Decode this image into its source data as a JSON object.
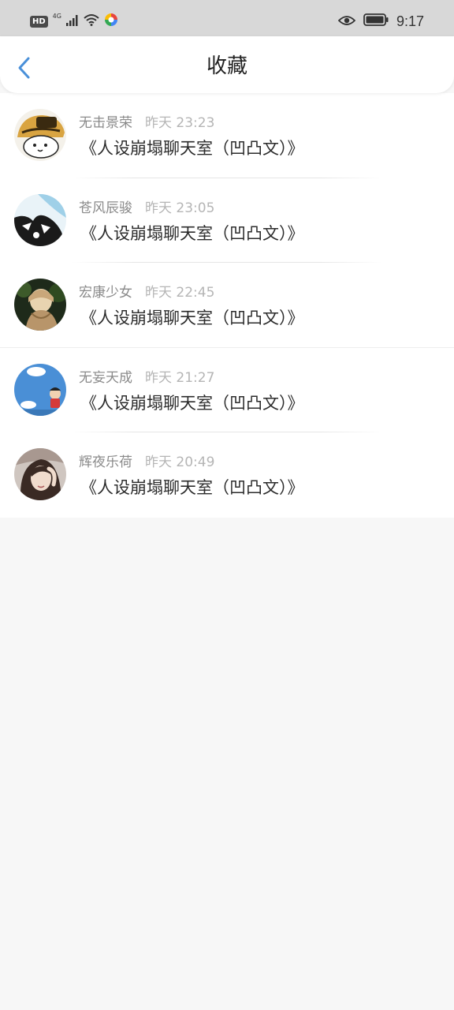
{
  "status_bar": {
    "hd": "HD",
    "network": "4G",
    "time": "9:17"
  },
  "header": {
    "title": "收藏"
  },
  "items": [
    {
      "name": "无击景荣",
      "time": "昨天 23:23",
      "title": "《人设崩塌聊天室（凹凸文）》"
    },
    {
      "name": "苍风辰骏",
      "time": "昨天 23:05",
      "title": "《人设崩塌聊天室（凹凸文）》"
    },
    {
      "name": "宏康少女",
      "time": "昨天 22:45",
      "title": "《人设崩塌聊天室（凹凸文）》"
    },
    {
      "name": "无妄天成",
      "time": "昨天 21:27",
      "title": "《人设崩塌聊天室（凹凸文）》"
    },
    {
      "name": "辉夜乐荷",
      "time": "昨天 20:49",
      "title": "《人设崩塌聊天室（凹凸文）》"
    }
  ],
  "colors": {
    "accent": "#4a90d9",
    "page_background": "#f7f7f7",
    "status_bar": "#d8d8d8"
  }
}
